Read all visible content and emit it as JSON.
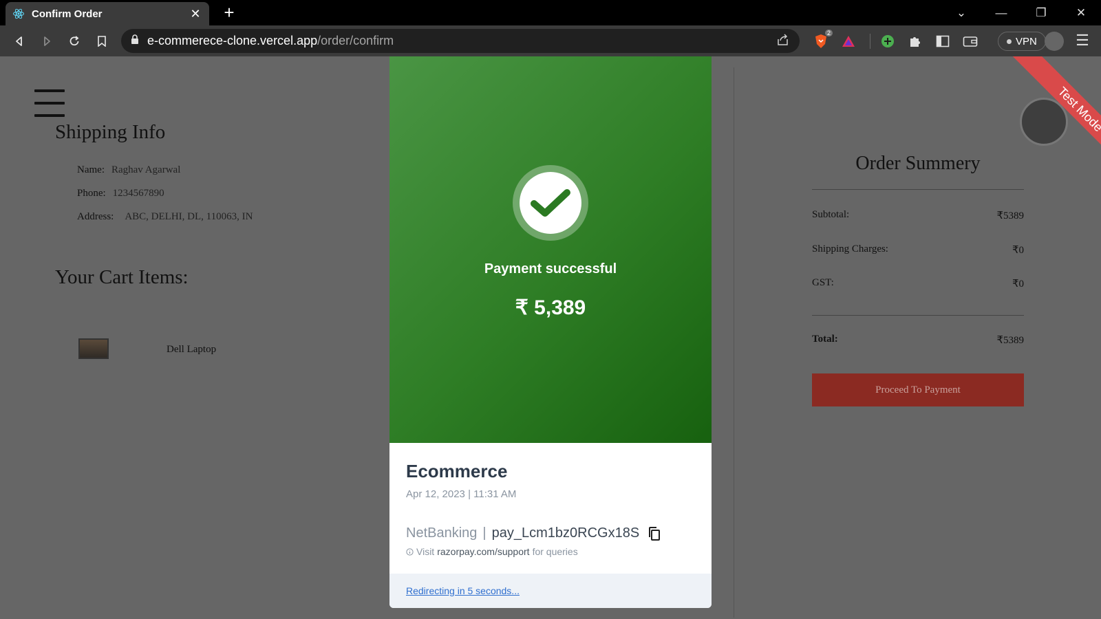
{
  "browser": {
    "tab_title": "Confirm Order",
    "url_host": "e-commerece-clone.vercel.app",
    "url_path": "/order/confirm",
    "brave_badge_count": "2",
    "vpn_label": "VPN"
  },
  "shipping": {
    "heading": "Shipping Info",
    "name_label": "Name:",
    "name_value": "Raghav Agarwal",
    "phone_label": "Phone:",
    "phone_value": "1234567890",
    "address_label": "Address:",
    "address_value": "ABC, DELHI, DL, 110063, IN"
  },
  "cart": {
    "heading": "Your Cart Items:",
    "items": [
      {
        "name": "Dell Laptop"
      }
    ]
  },
  "summary": {
    "heading": "Order Summery",
    "subtotal_label": "Subtotal:",
    "subtotal_value": "₹5389",
    "shipping_label": "Shipping Charges:",
    "shipping_value": "₹0",
    "gst_label": "GST:",
    "gst_value": "₹0",
    "total_label": "Total:",
    "total_value": "₹5389",
    "proceed_label": "Proceed To Payment"
  },
  "ribbon": {
    "label": "Test Mode"
  },
  "razorpay": {
    "status": "Payment successful",
    "amount": "₹ 5,389",
    "merchant": "Ecommerce",
    "date": "Apr 12, 2023 | 11:31 AM",
    "method": "NetBanking",
    "payment_id": "pay_Lcm1bz0RCGx18S",
    "support_prefix": "Visit",
    "support_link": "razorpay.com/support",
    "support_suffix": "for queries",
    "redirect": "Redirecting in 5 seconds..."
  },
  "colors": {
    "success_green": "#2e7d25",
    "proceed_red": "#8b2a22",
    "ribbon_red": "#d94a4a",
    "link_blue": "#2f6fcf"
  }
}
